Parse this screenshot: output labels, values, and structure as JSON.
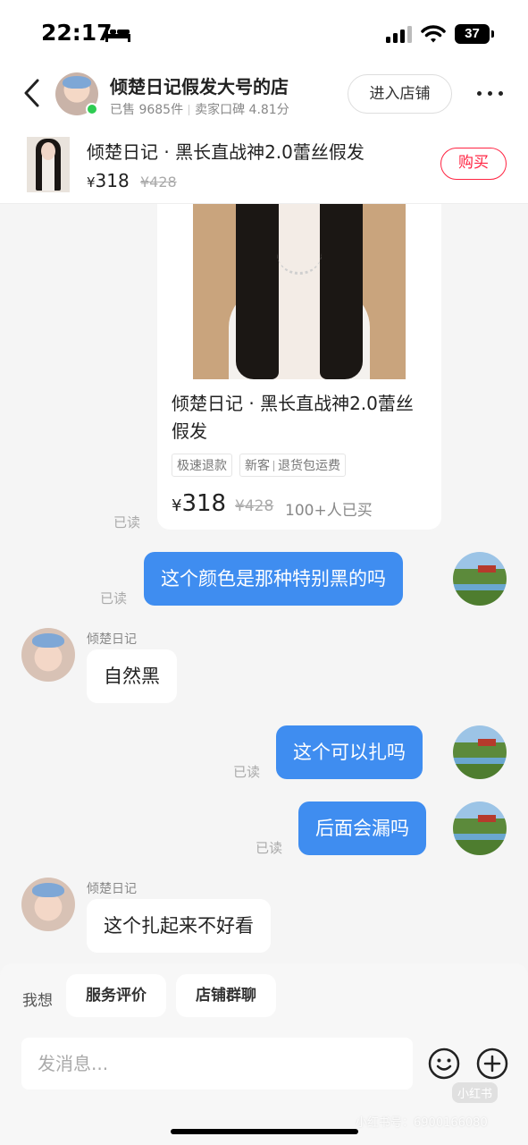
{
  "status_bar": {
    "time": "22:17",
    "battery": "37"
  },
  "header": {
    "shop_name": "倾楚日记假发大号的店",
    "sold": "已售 9685件",
    "rating": "卖家口碑 4.81分",
    "enter_shop_label": "进入店铺"
  },
  "product_bar": {
    "title": "倾楚日记 · 黑长直战神2.0蕾丝假发",
    "price_symbol": "¥",
    "price": "318",
    "old_price": "¥428",
    "buy_label": "购买"
  },
  "product_card": {
    "title": "倾楚日记 · 黑长直战神2.0蕾丝假发",
    "tag1": "极速退款",
    "tag2a": "新客",
    "tag2b": "退货包运费",
    "price_symbol": "¥",
    "price": "318",
    "old_price": "¥428",
    "sold": "100+人已买"
  },
  "read_label": "已读",
  "messages": [
    {
      "from": "me",
      "text": "这个颜色是那种特别黑的吗"
    },
    {
      "from": "them",
      "sender": "倾楚日记",
      "text": "自然黑"
    },
    {
      "from": "me",
      "text": "这个可以扎吗"
    },
    {
      "from": "me",
      "text": "后面会漏吗"
    },
    {
      "from": "them",
      "sender": "倾楚日记",
      "text": "这个扎起来不好看"
    }
  ],
  "bottom": {
    "want_label": "我想",
    "quick_replies": [
      "服务评价",
      "店铺群聊"
    ],
    "input_placeholder": "发消息..."
  },
  "watermark": {
    "logo": "小红书",
    "id": "小红书号：6900166080"
  },
  "colors": {
    "accent_blue": "#3f8df0",
    "buy_red": "#ff2442",
    "online_green": "#2ecc52"
  },
  "icons": [
    "bed-icon",
    "signal-icon",
    "wifi-icon",
    "back-icon",
    "more-icon",
    "emoji-icon",
    "plus-icon"
  ]
}
